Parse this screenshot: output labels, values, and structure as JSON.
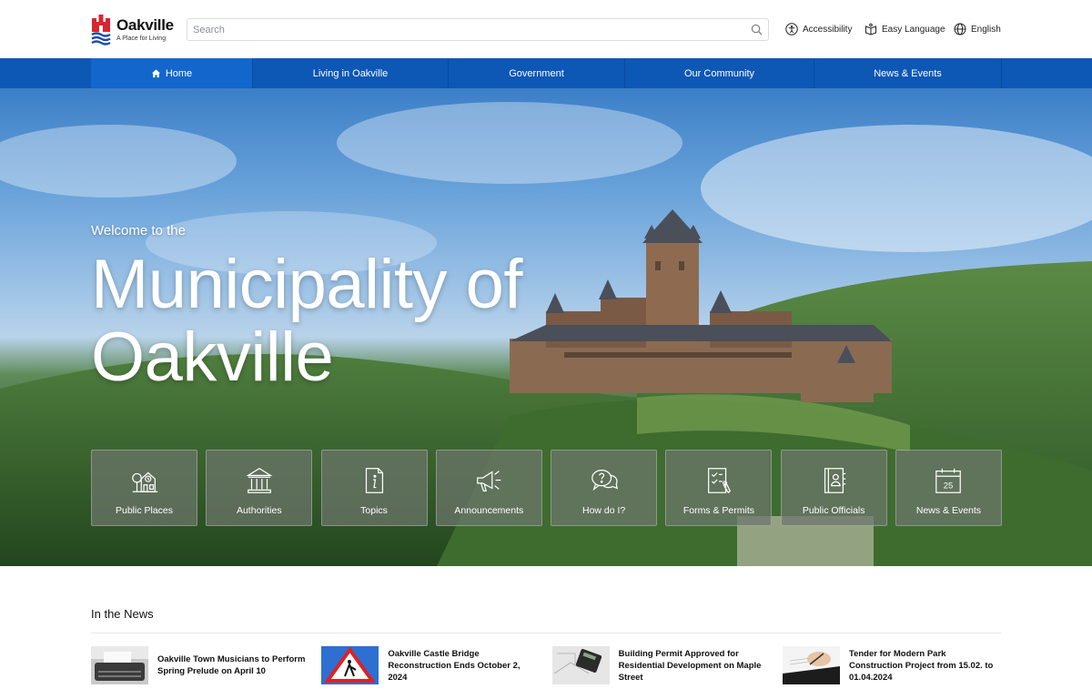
{
  "brand": {
    "name": "Oakville",
    "tagline": "A Place for Living",
    "colors": {
      "primary": "#0d57b5",
      "logo_red": "#d7262f",
      "logo_blue": "#1b4ea3"
    }
  },
  "search": {
    "placeholder": "Search",
    "value": ""
  },
  "utilities": {
    "accessibility": "Accessibility",
    "easy_language": "Easy Language",
    "language": "English"
  },
  "nav": {
    "items": [
      {
        "label": "Home",
        "icon": "home-icon",
        "active": true
      },
      {
        "label": "Living in Oakville"
      },
      {
        "label": "Government"
      },
      {
        "label": "Our Community"
      },
      {
        "label": "News & Events"
      }
    ]
  },
  "hero": {
    "welcome": "Welcome to the",
    "title": "Municipality of Oakville"
  },
  "tiles": [
    {
      "label": "Public Places",
      "icon": "park-clock-icon"
    },
    {
      "label": "Authorities",
      "icon": "building-icon"
    },
    {
      "label": "Topics",
      "icon": "info-document-icon"
    },
    {
      "label": "Announcements",
      "icon": "megaphone-icon"
    },
    {
      "label": "How do I?",
      "icon": "question-chat-icon"
    },
    {
      "label": "Forms & Permits",
      "icon": "checklist-icon"
    },
    {
      "label": "Public Officials",
      "icon": "contact-book-icon"
    },
    {
      "label": "News & Events",
      "icon": "calendar-icon",
      "calendar_day": "25"
    }
  ],
  "news": {
    "heading": "In the News",
    "items": [
      {
        "title": "Oakville Town Musicians to Perform Spring Prelude on April 10",
        "thumb": "typewriter-thumb"
      },
      {
        "title": "Oakville Castle Bridge Reconstruction Ends October 2, 2024",
        "thumb": "roadwork-sign-thumb"
      },
      {
        "title": "Building Permit Approved for Residential Development on Maple Street",
        "thumb": "calculator-plans-thumb"
      },
      {
        "title": "Tender for Modern Park Construction Project from 15.02. to 01.04.2024",
        "thumb": "signing-document-thumb"
      }
    ]
  }
}
